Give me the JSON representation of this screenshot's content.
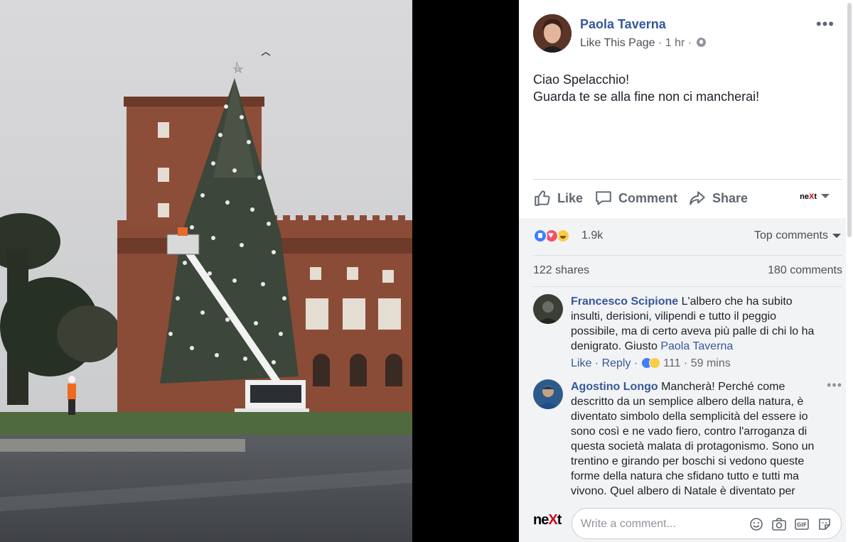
{
  "post": {
    "author": "Paola Taverna",
    "like_page": "Like This Page",
    "separator": "·",
    "time": "1 hr",
    "text_lines": [
      "Ciao Spelacchio!",
      "Guarda te se alla fine non ci mancherai!"
    ]
  },
  "actions": {
    "like": "Like",
    "comment": "Comment",
    "share": "Share",
    "page_logo_left": "ne",
    "page_logo_x": "X",
    "page_logo_right": "t"
  },
  "reactions": {
    "count": "1.9k",
    "sort_label": "Top comments"
  },
  "stats": {
    "shares": "122 shares",
    "comments": "180 comments"
  },
  "comments": [
    {
      "author": "Francesco Scipione",
      "text": "L'albero che ha subito insulti, derisioni, vilipendi e tutto il peggio possibile, ma di certo aveva più palle di chi lo ha denigrato. Giusto",
      "mention": "Paola Taverna",
      "like": "Like",
      "reply": "Reply",
      "reaction_count": "111",
      "time": "59 mins"
    },
    {
      "author": "Agostino Longo",
      "text": "Mancherà! Perché come descritto da un semplice albero della natura, è diventato simbolo della semplicità del essere io sono così e ne vado fiero, contro l'arroganza di questa società malata di protagonismo. Sono un trentino e girando per boschi si vedono queste forme della natura che sfidano tutto e tutti ma vivono. Quel albero di Natale è diventato per"
    }
  ],
  "composer": {
    "logo_left": "ne",
    "logo_x": "X",
    "logo_right": "t",
    "placeholder": "Write a comment..."
  },
  "colors": {
    "link_blue": "#365899",
    "like_blue": "#4080ff",
    "love_red": "#f25268",
    "haha_yellow": "#fbcd44",
    "next_red": "#d0021b"
  }
}
